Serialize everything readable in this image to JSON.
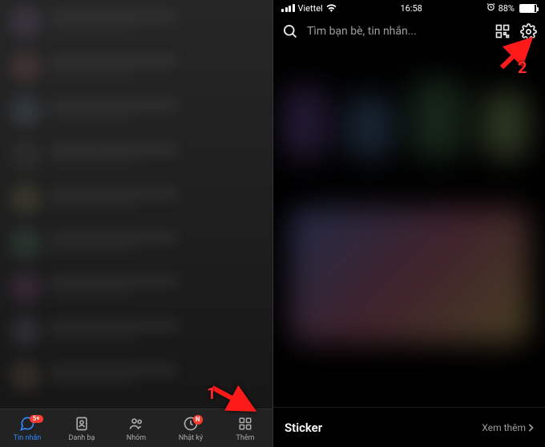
{
  "left": {
    "tabs": {
      "messages": {
        "label": "Tin nhắn",
        "badge": "5+"
      },
      "contacts": {
        "label": "Danh bạ"
      },
      "groups": {
        "label": "Nhóm"
      },
      "timeline": {
        "label": "Nhật ký",
        "badge": "N"
      },
      "more": {
        "label": "Thêm"
      }
    },
    "annotation_number": "1"
  },
  "right": {
    "status": {
      "carrier": "Viettel",
      "time": "16:58",
      "battery_pct": "88%"
    },
    "search": {
      "placeholder": "Tìm bạn bè, tin nhắn..."
    },
    "sticker": {
      "title": "Sticker",
      "more_label": "Xem thêm"
    },
    "annotation_number": "2"
  }
}
